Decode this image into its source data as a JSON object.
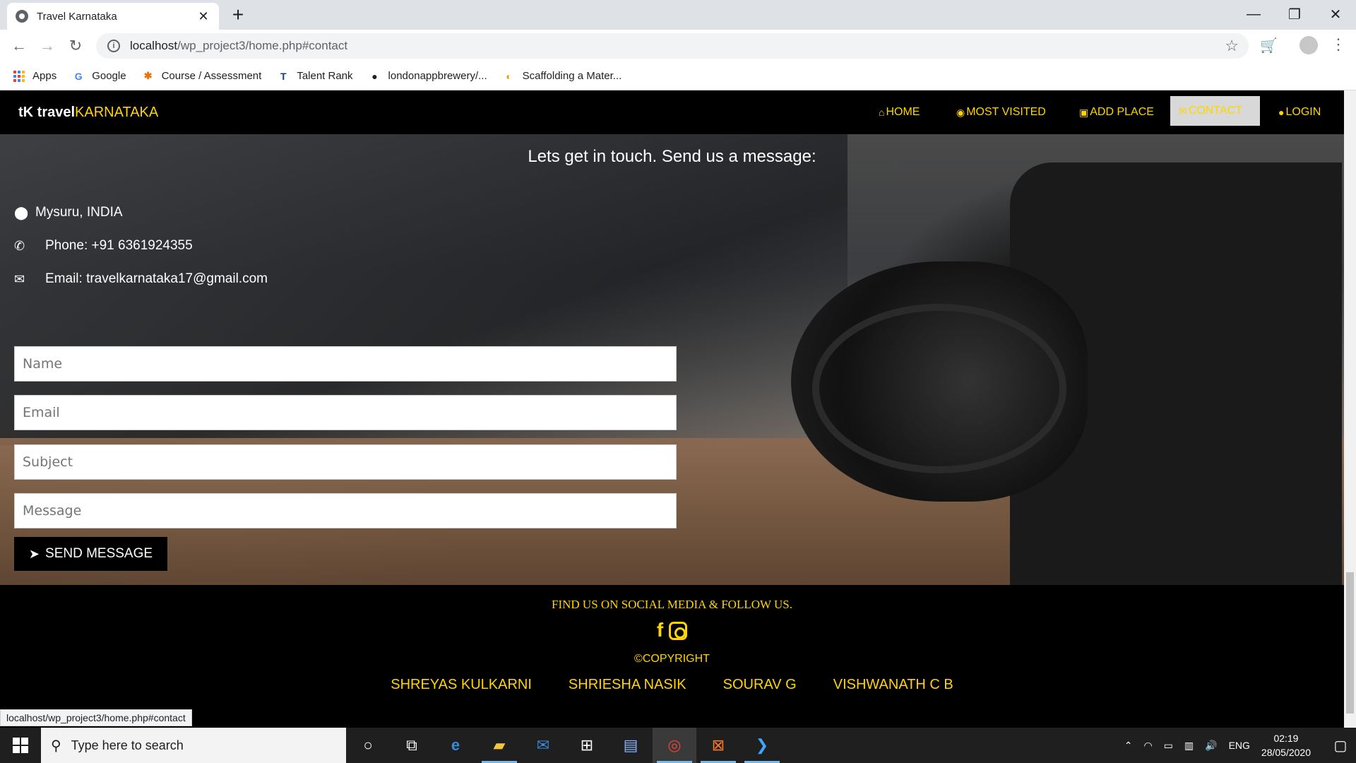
{
  "browser": {
    "tab_title": "Travel Karnataka",
    "tab_close": "✕",
    "new_tab": "+",
    "url_host": "localhost",
    "url_path": "/wp_project3/home.php#contact",
    "status_url": "localhost/wp_project3/home.php#contact",
    "bookmarks": [
      {
        "label": "Apps",
        "icon": "apps-grid-icon"
      },
      {
        "label": "Google",
        "icon": "google-icon",
        "glyph": "G",
        "color": "#4285f4"
      },
      {
        "label": "Course / Assessment",
        "icon": "course-icon",
        "glyph": "✱",
        "color": "#e8710a"
      },
      {
        "label": "Talent Rank",
        "icon": "talent-rank-icon",
        "glyph": "T",
        "color": "#1a3d7c"
      },
      {
        "label": "londonappbrewery/...",
        "icon": "github-icon",
        "glyph": "●",
        "color": "#202124"
      },
      {
        "label": "Scaffolding a Mater...",
        "icon": "scaffolding-icon",
        "glyph": "◐",
        "color": "#d9a400"
      }
    ]
  },
  "site": {
    "logo_mark": "tK",
    "logo_word": "travel",
    "logo_highlight": "KARNATAKA",
    "nav": [
      {
        "label": "HOME",
        "icon": "home-icon",
        "glyph": "⌂"
      },
      {
        "label": "MOST VISITED",
        "icon": "eye-icon",
        "glyph": "◉"
      },
      {
        "label": "ADD PLACE",
        "icon": "camera-icon",
        "glyph": "▣"
      },
      {
        "label": "CONTACT",
        "icon": "envelope-icon",
        "glyph": "✉",
        "active": true
      },
      {
        "label": "LOGIN",
        "icon": "user-icon",
        "glyph": "●"
      }
    ],
    "accent_color": "#ffd400"
  },
  "contact": {
    "heading": "Lets get in touch. Send us a message:",
    "location": "Mysuru, INDIA",
    "phone": "Phone: +91 6361924355",
    "email": "Email: travelkarnataka17@gmail.com",
    "form": {
      "name_placeholder": "Name",
      "email_placeholder": "Email",
      "subject_placeholder": "Subject",
      "message_placeholder": "Message",
      "submit_label": "SEND MESSAGE"
    }
  },
  "footer": {
    "follow_text": "FIND US ON SOCIAL MEDIA & FOLLOW US.",
    "social": [
      {
        "icon": "facebook-icon",
        "glyph": "f"
      },
      {
        "icon": "instagram-icon"
      }
    ],
    "copyright": "©COPYRIGHT",
    "authors": [
      "SHREYAS KULKARNI",
      "SHRIESHA NASIK",
      "SOURAV G",
      "VISHWANATH C B"
    ]
  },
  "taskbar": {
    "search_placeholder": "Type here to search",
    "language": "ENG",
    "time": "02:19",
    "date": "28/05/2020"
  }
}
